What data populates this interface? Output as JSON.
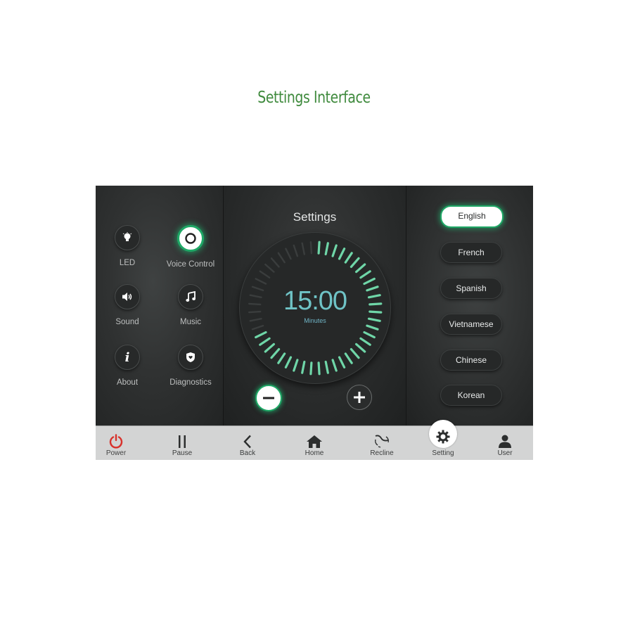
{
  "page": {
    "title": "Settings Interface"
  },
  "left_panel": {
    "features": [
      {
        "label": "LED",
        "icon": "lightbulb-icon",
        "active": false
      },
      {
        "label": "Voice Control",
        "icon": "voice-ring-icon",
        "active": true
      },
      {
        "label": "Sound",
        "icon": "speaker-icon",
        "active": false
      },
      {
        "label": "Music",
        "icon": "music-note-icon",
        "active": false
      },
      {
        "label": "About",
        "icon": "info-icon",
        "active": false
      },
      {
        "label": "Diagnostics",
        "icon": "shield-heart-icon",
        "active": false
      }
    ]
  },
  "mid_panel": {
    "title": "Settings",
    "timer": {
      "value": "15:00",
      "unit": "Minutes",
      "total_ticks": 48,
      "lit_fraction": 0.69
    },
    "minus_label": "decrease",
    "plus_label": "increase"
  },
  "right_panel": {
    "languages": [
      {
        "label": "English",
        "active": true
      },
      {
        "label": "French",
        "active": false
      },
      {
        "label": "Spanish",
        "active": false
      },
      {
        "label": "Vietnamese",
        "active": false
      },
      {
        "label": "Chinese",
        "active": false
      },
      {
        "label": "Korean",
        "active": false
      }
    ]
  },
  "nav": {
    "items": [
      {
        "label": "Power",
        "icon": "power-icon"
      },
      {
        "label": "Pause",
        "icon": "pause-icon"
      },
      {
        "label": "Back",
        "icon": "chevron-left-icon"
      },
      {
        "label": "Home",
        "icon": "home-icon"
      },
      {
        "label": "Recline",
        "icon": "recline-icon"
      },
      {
        "label": "Setting",
        "icon": "gear-icon",
        "active": true
      },
      {
        "label": "User",
        "icon": "user-icon"
      }
    ]
  },
  "colors": {
    "accent_green": "#1fa866",
    "tick_lit": "#6fd6a8",
    "tick_dim": "#3a3d3d",
    "timer_text": "#6fc3c6",
    "power_red": "#d8322c",
    "title_green": "#3f8a3d"
  }
}
